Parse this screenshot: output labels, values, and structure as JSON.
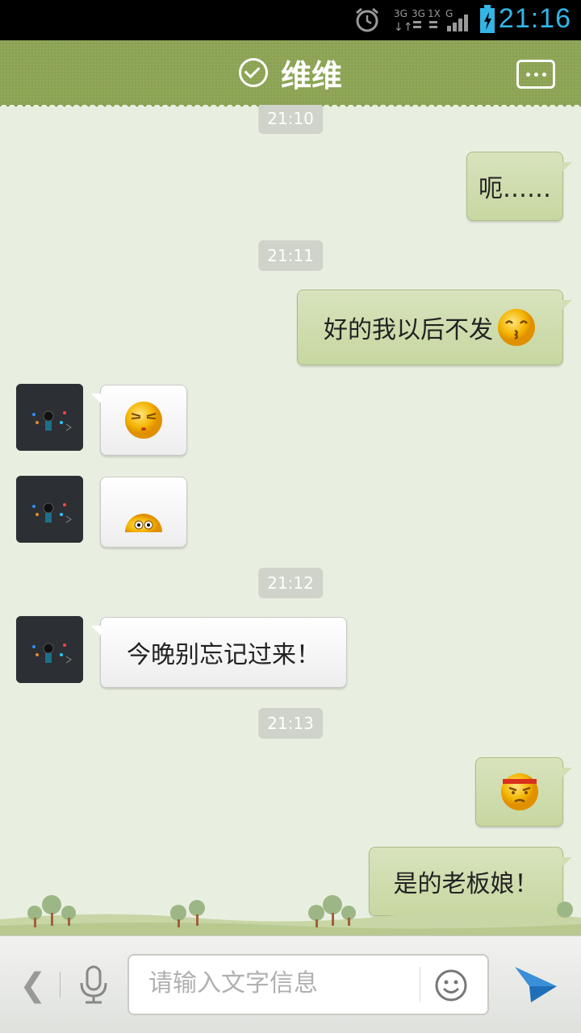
{
  "status_bar": {
    "time": "21:16",
    "network_labels": [
      "3G",
      "3G",
      "1X",
      "G"
    ],
    "icons": [
      "alarm-icon",
      "network-icon",
      "signal-icon",
      "battery-charging-icon"
    ]
  },
  "header": {
    "title": "维维",
    "status_icon": "check-circle-icon",
    "more_icon": "more-dots-icon"
  },
  "messages": [
    {
      "type": "time",
      "text": "21:10"
    },
    {
      "type": "out",
      "text": "呃……"
    },
    {
      "type": "time",
      "text": "21:11"
    },
    {
      "type": "out",
      "text": "好的我以后不发",
      "emoji": "kiss-emoji-icon"
    },
    {
      "type": "in",
      "emoji": "squint-emoji-icon"
    },
    {
      "type": "in",
      "emoji": "peek-emoji-icon"
    },
    {
      "type": "time",
      "text": "21:12"
    },
    {
      "type": "in",
      "text": "今晚别忘记过来！"
    },
    {
      "type": "time",
      "text": "21:13"
    },
    {
      "type": "out",
      "emoji": "angry-headband-emoji-icon"
    },
    {
      "type": "out",
      "text": "是的老板娘！"
    }
  ],
  "input_bar": {
    "back_label": "❮",
    "placeholder": "请输入文字信息",
    "value": "",
    "icons": [
      "back-icon",
      "microphone-icon",
      "smiley-icon",
      "send-icon"
    ]
  },
  "colors": {
    "header": "#8ba353",
    "outgoing_bubble": "#cddba9",
    "incoming_bubble": "#ffffff",
    "background": "#e9efe0",
    "clock": "#33b5e5"
  }
}
